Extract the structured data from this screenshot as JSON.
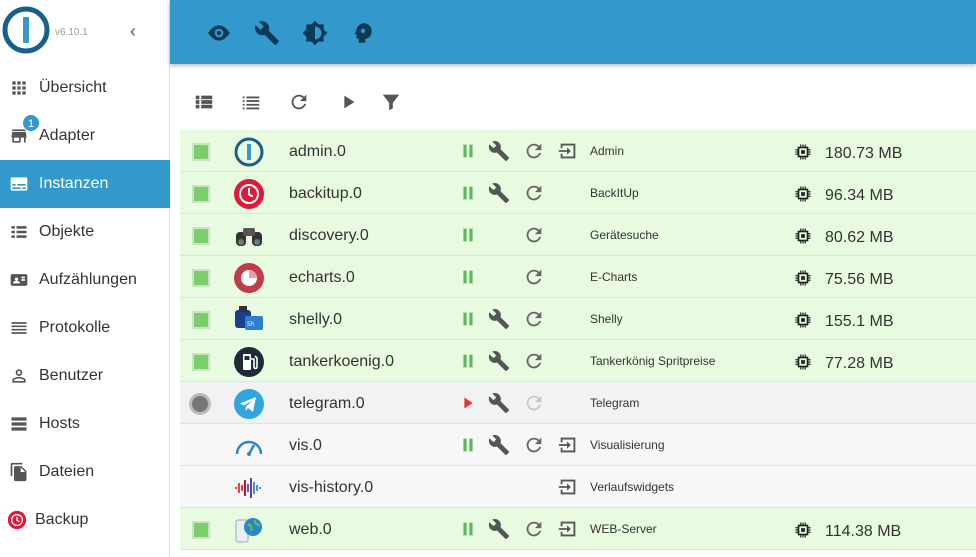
{
  "app": {
    "version": "v6.10.1"
  },
  "sidebar": {
    "adapter_badge": "1",
    "items": [
      {
        "label": "Übersicht",
        "icon": "grid-icon"
      },
      {
        "label": "Adapter",
        "icon": "store-icon"
      },
      {
        "label": "Instanzen",
        "icon": "instances-icon",
        "active": true
      },
      {
        "label": "Objekte",
        "icon": "list-icon"
      },
      {
        "label": "Aufzählungen",
        "icon": "enum-icon"
      },
      {
        "label": "Protokolle",
        "icon": "log-icon"
      },
      {
        "label": "Benutzer",
        "icon": "user-icon"
      },
      {
        "label": "Hosts",
        "icon": "hosts-icon"
      },
      {
        "label": "Dateien",
        "icon": "files-icon"
      },
      {
        "label": "Backup",
        "icon": "backup-icon"
      }
    ]
  },
  "topbar": {
    "icons": [
      "eye-icon",
      "wrench-icon",
      "theme-icon",
      "expert-icon"
    ]
  },
  "toolbar": {
    "icons": [
      "compact-view-icon",
      "list-view-icon",
      "refresh-icon",
      "play-icon",
      "filter-icon"
    ]
  },
  "colors": {
    "accent": "#3399cc",
    "running": "#7ccd6b",
    "row_green": "#e8fbe0",
    "play_red": "#e53935"
  },
  "instances": [
    {
      "name": "admin.0",
      "title": "Admin",
      "memory": "180.73 MB",
      "status": "running",
      "run": "pause",
      "settings": true,
      "reload": true,
      "link": true,
      "icon": "admin-icon"
    },
    {
      "name": "backitup.0",
      "title": "BackItUp",
      "memory": "96.34 MB",
      "status": "running",
      "run": "pause",
      "settings": true,
      "reload": true,
      "link": false,
      "icon": "backitup-icon"
    },
    {
      "name": "discovery.0",
      "title": "Gerätesuche",
      "memory": "80.62 MB",
      "status": "running",
      "run": "pause",
      "settings": false,
      "reload": true,
      "link": false,
      "icon": "binoculars-icon"
    },
    {
      "name": "echarts.0",
      "title": "E-Charts",
      "memory": "75.56 MB",
      "status": "running",
      "run": "pause",
      "settings": false,
      "reload": true,
      "link": false,
      "icon": "echarts-icon"
    },
    {
      "name": "shelly.0",
      "title": "Shelly",
      "memory": "155.1 MB",
      "status": "running",
      "run": "pause",
      "settings": true,
      "reload": true,
      "link": false,
      "icon": "shelly-icon"
    },
    {
      "name": "tankerkoenig.0",
      "title": "Tankerkönig Spritpreise",
      "memory": "77.28 MB",
      "status": "running",
      "run": "pause",
      "settings": true,
      "reload": true,
      "link": false,
      "icon": "fuel-icon"
    },
    {
      "name": "telegram.0",
      "title": "Telegram",
      "memory": "",
      "status": "stopped",
      "run": "play",
      "settings": true,
      "reload": "disabled",
      "link": false,
      "icon": "telegram-icon"
    },
    {
      "name": "vis.0",
      "title": "Visualisierung",
      "memory": "",
      "status": "none",
      "run": "pause",
      "settings": true,
      "reload": true,
      "link": true,
      "icon": "vis-icon"
    },
    {
      "name": "vis-history.0",
      "title": "Verlaufswidgets",
      "memory": "",
      "status": "none",
      "run": "none",
      "settings": false,
      "reload": false,
      "link": true,
      "icon": "vis-history-icon"
    },
    {
      "name": "web.0",
      "title": "WEB-Server",
      "memory": "114.38 MB",
      "status": "running",
      "run": "pause",
      "settings": true,
      "reload": true,
      "link": true,
      "icon": "web-icon"
    }
  ]
}
